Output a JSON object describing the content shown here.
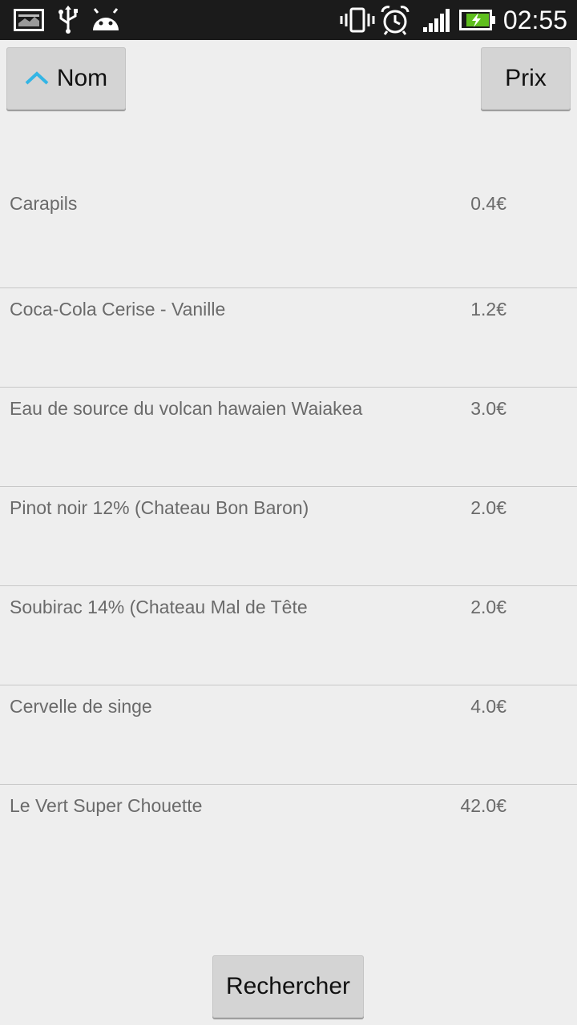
{
  "status_bar": {
    "time": "02:55",
    "icons": [
      "image-notification-icon",
      "usb-icon",
      "android-debug-icon",
      "vibrate-icon",
      "alarm-icon",
      "signal-icon",
      "battery-charging-icon"
    ]
  },
  "sort": {
    "name_label": "Nom",
    "price_label": "Prix",
    "active": "Nom",
    "direction": "ascending",
    "accent": "#33b5e5"
  },
  "items": [
    {
      "name": "Carapils",
      "price": "0.4€"
    },
    {
      "name": "Coca-Cola Cerise - Vanille",
      "price": "1.2€"
    },
    {
      "name": "Eau de source du volcan hawaien Waiakea",
      "price": "3.0€"
    },
    {
      "name": "Pinot noir 12% (Chateau Bon Baron)",
      "price": "2.0€"
    },
    {
      "name": "Soubirac 14% (Chateau Mal de Tête",
      "price": "2.0€"
    },
    {
      "name": "Cervelle de singe",
      "price": "4.0€"
    },
    {
      "name": "Le Vert Super Chouette",
      "price": "42.0€"
    }
  ],
  "search_button_label": "Rechercher"
}
